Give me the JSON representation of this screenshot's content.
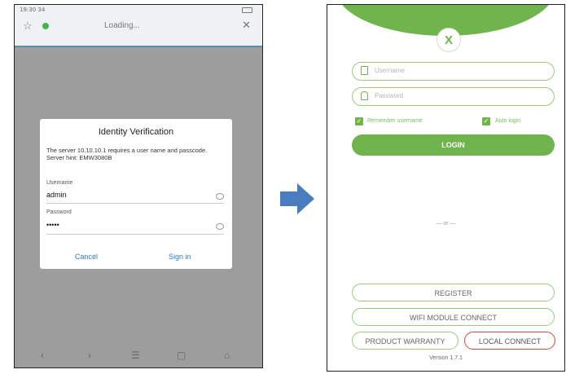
{
  "left_phone": {
    "status_time": "19:30 34 ",
    "browser": {
      "star_glyph": "☆",
      "loading_text": "Loading...",
      "close_glyph": "✕"
    },
    "dialog": {
      "title": "Identity Verification",
      "message": "The server 10.10.10.1 requires a user name and passcode. Server hint: EMW3080B",
      "username_label": "Username",
      "username_value": "admin",
      "password_label": "Password",
      "password_value": "•••••",
      "cancel_label": "Cancel",
      "signin_label": "Sign in"
    },
    "nav": {
      "back": "‹",
      "forward": "›",
      "menu": "☰",
      "tabs": "▢",
      "home": "⌂"
    }
  },
  "right_phone": {
    "logo_glyph": "X",
    "username_placeholder": "Username",
    "password_placeholder": "Password",
    "remember_label": "Remember username",
    "autologin_label": "Auto login",
    "login_label": "LOGIN",
    "or_text": "— or —",
    "register_label": "REGISTER",
    "wifi_label": "WIFI MODULE CONNECT",
    "warranty_label": "PRODUCT WARRANTY",
    "local_label": "LOCAL CONNECT",
    "version_text": "Version 1.7.1"
  },
  "colors": {
    "accent_green": "#6fb44d",
    "highlight_red": "#d9463d",
    "link_blue": "#2d7fc4",
    "arrow_blue": "#4a7cc0"
  }
}
